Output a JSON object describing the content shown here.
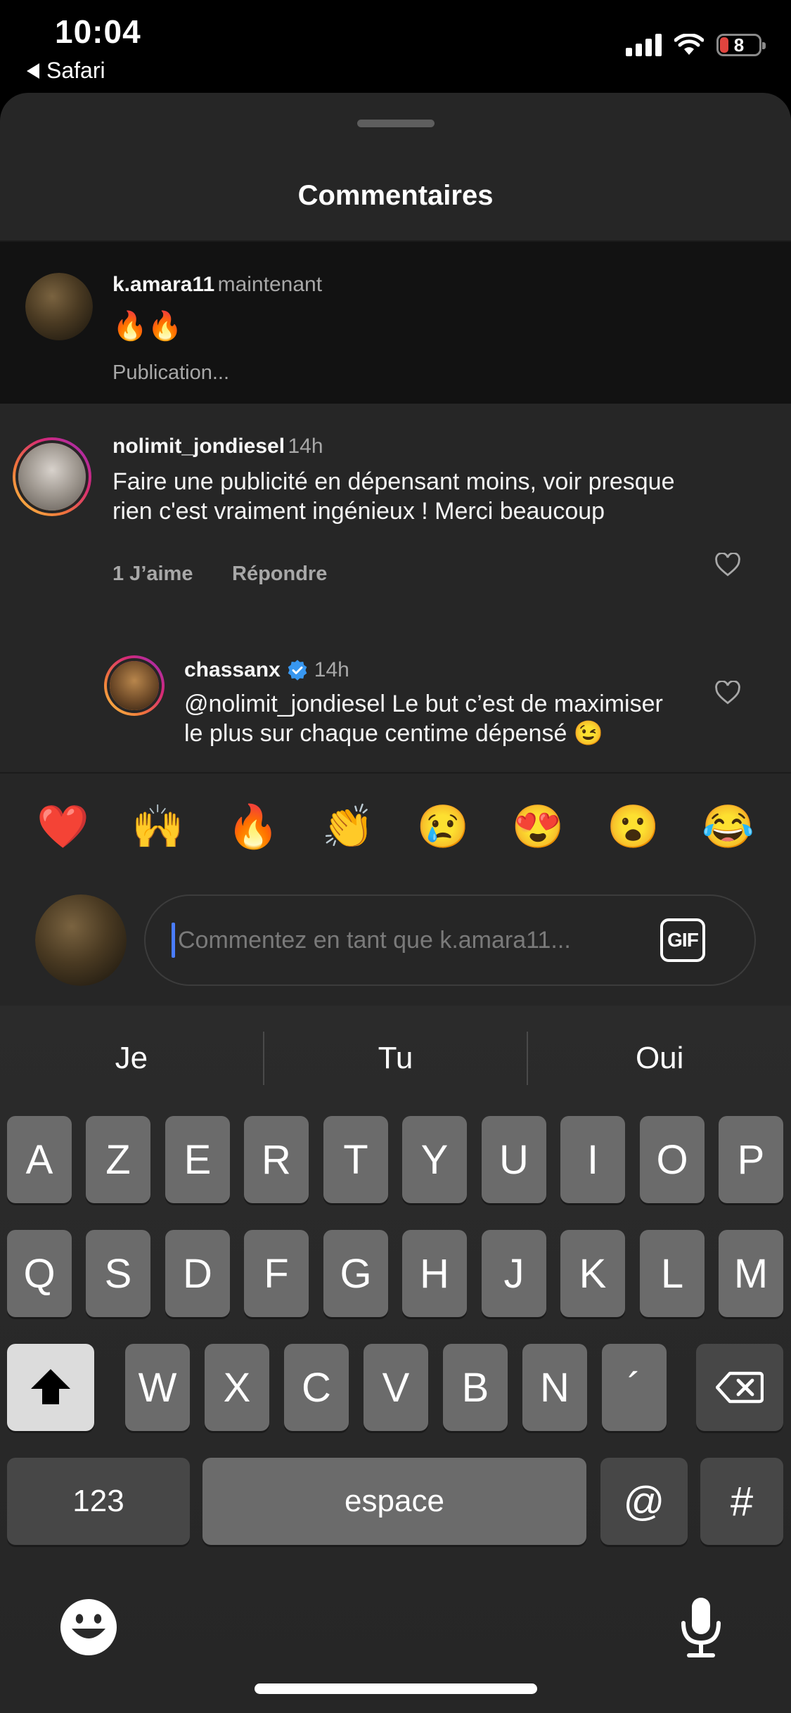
{
  "status_bar": {
    "time": "10:04",
    "back_app": "Safari",
    "battery": "8"
  },
  "sheet": {
    "title": "Commentaires"
  },
  "pending_comment": {
    "username": "k.amara11",
    "time": "maintenant",
    "text": "🔥🔥",
    "status": "Publication..."
  },
  "comments": [
    {
      "username": "nolimit_jondiesel",
      "time": "14h",
      "text": "Faire une publicité en dépensant moins, voir presque rien c'est vraiment ingénieux ! Merci beaucoup",
      "likes": "1 J’aime",
      "reply_label": "Répondre"
    },
    {
      "username": "chassanx",
      "time": "14h",
      "verified": true,
      "text": "@nolimit_jondiesel Le but c’est de maximiser le plus sur chaque centime dépensé 😉"
    }
  ],
  "emoji_bar": [
    "❤️",
    "🙌",
    "🔥",
    "👏",
    "😢",
    "😍",
    "😮",
    "😂"
  ],
  "comment_input": {
    "placeholder": "Commentez en tant que k.amara11...",
    "gif_label": "GIF"
  },
  "keyboard": {
    "suggestions": [
      "Je",
      "Tu",
      "Oui"
    ],
    "row1": [
      "A",
      "Z",
      "E",
      "R",
      "T",
      "Y",
      "U",
      "I",
      "O",
      "P"
    ],
    "row2": [
      "Q",
      "S",
      "D",
      "F",
      "G",
      "H",
      "J",
      "K",
      "L",
      "M"
    ],
    "row3": [
      "W",
      "X",
      "C",
      "V",
      "B",
      "N",
      "´"
    ],
    "numbers_key": "123",
    "space_key": "espace",
    "at_key": "@",
    "hash_key": "#"
  },
  "colors": {
    "accent_caret": "#4a7dff",
    "verified": "#3897f0",
    "sheet_bg": "#262626"
  }
}
